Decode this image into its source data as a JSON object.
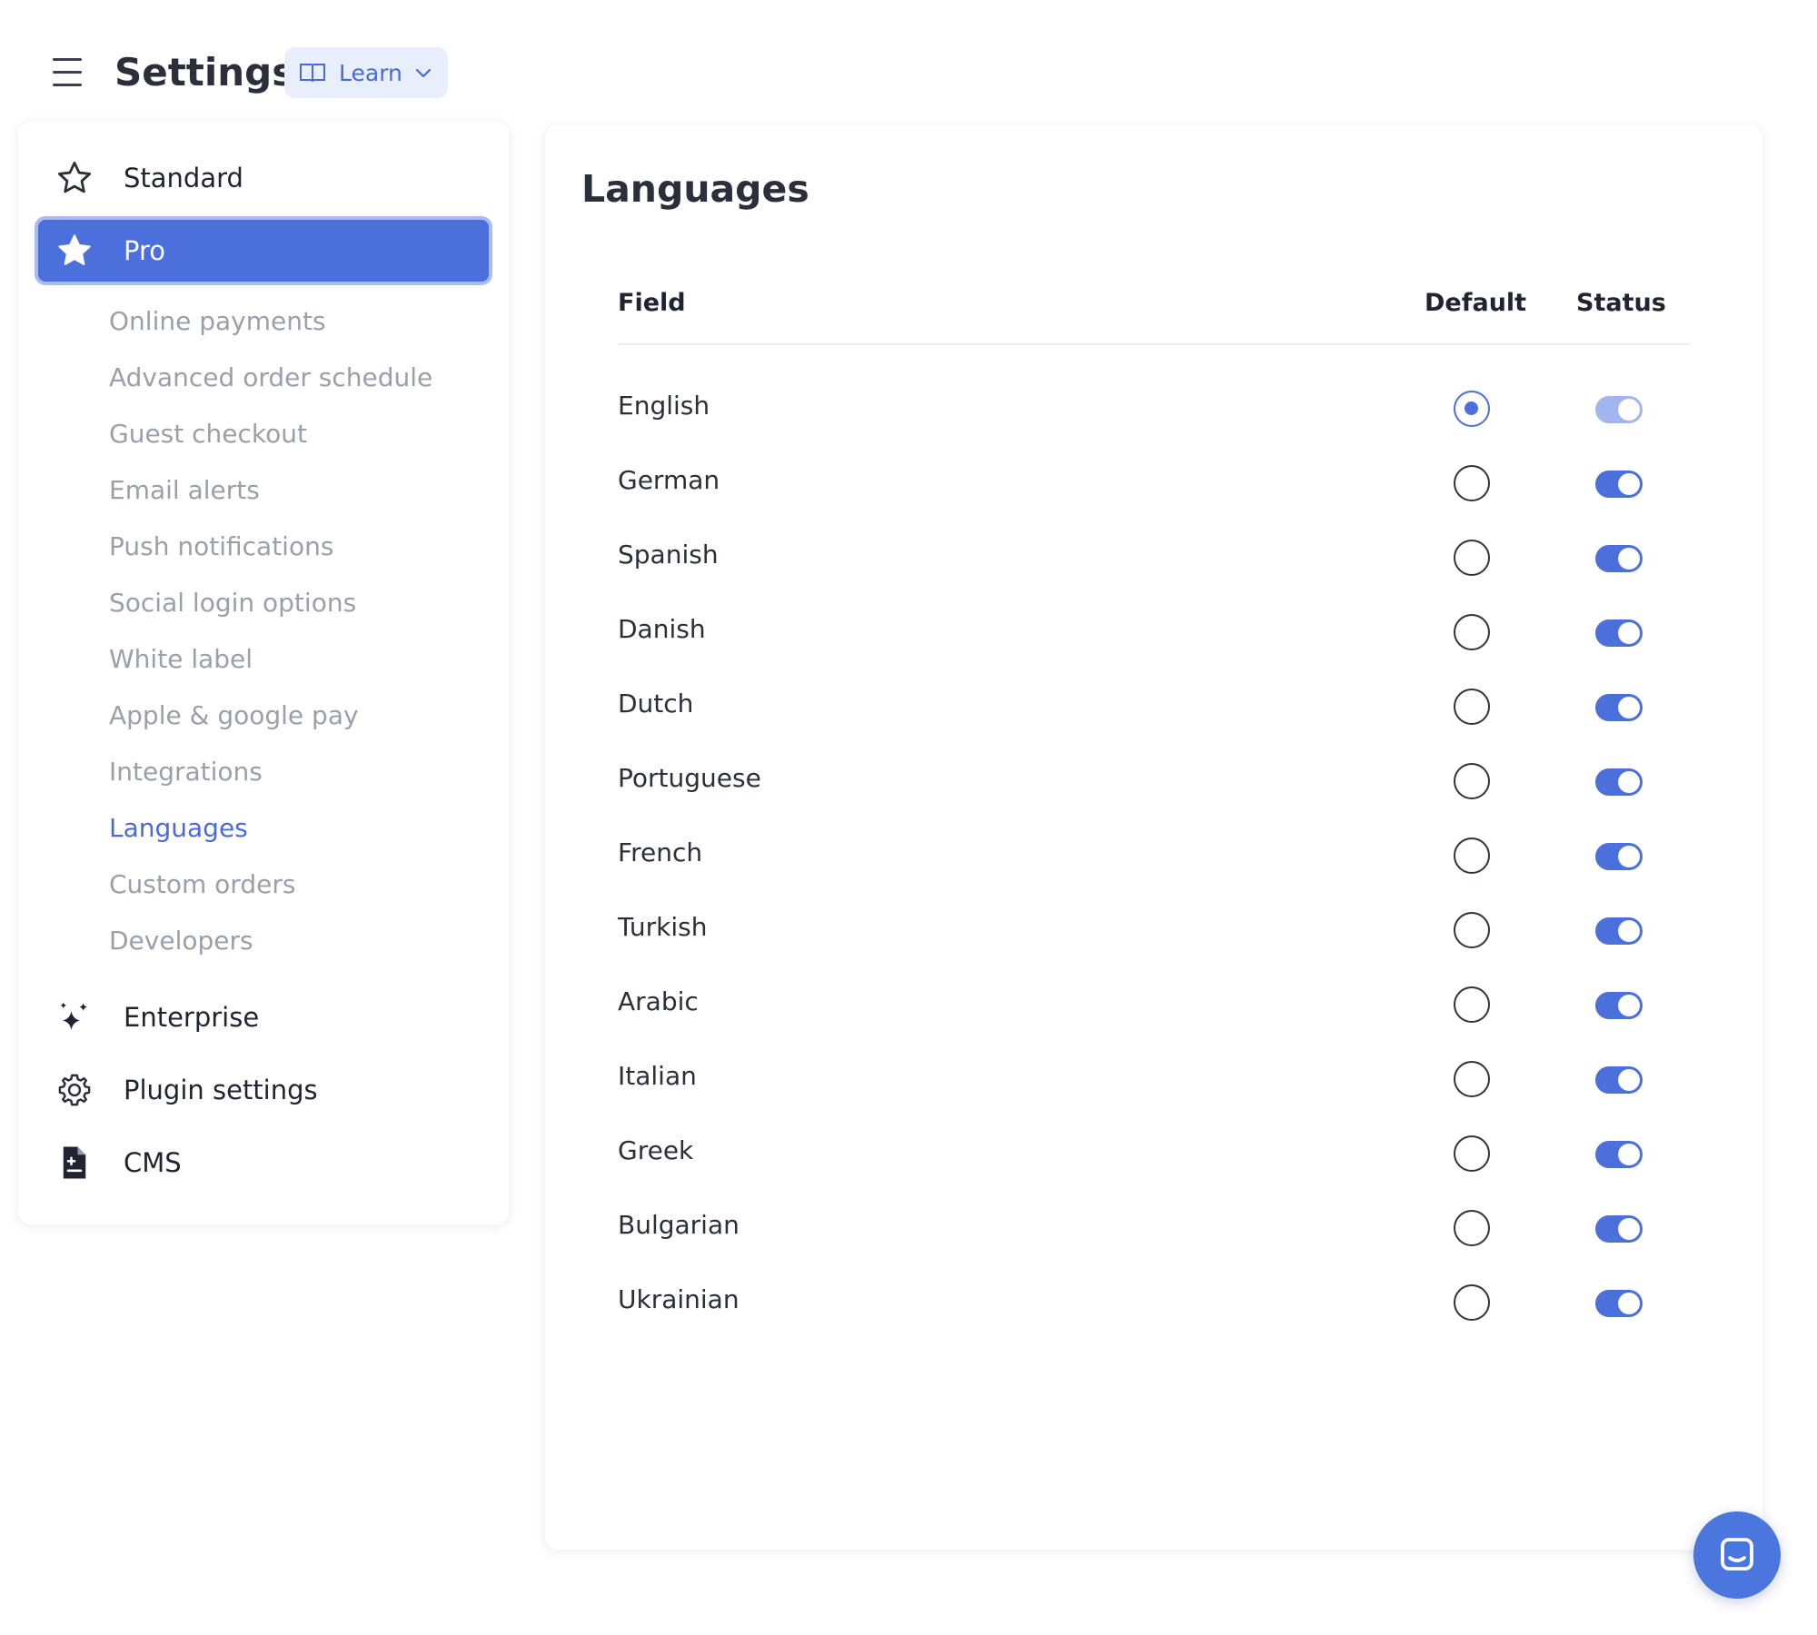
{
  "header": {
    "title": "Settings",
    "learn_label": "Learn"
  },
  "sidebar": {
    "items": [
      {
        "label": "Standard",
        "icon": "star-outline-icon"
      },
      {
        "label": "Pro",
        "icon": "star-filled-icon",
        "active": true
      },
      {
        "label": "Enterprise",
        "icon": "sparkles-icon"
      },
      {
        "label": "Plugin settings",
        "icon": "gear-icon"
      },
      {
        "label": "CMS",
        "icon": "document-icon"
      }
    ],
    "pro_subitems": [
      "Online payments",
      "Advanced order schedule",
      "Guest checkout",
      "Email alerts",
      "Push notifications",
      "Social login options",
      "White label",
      "Apple & google pay",
      "Integrations",
      "Languages",
      "Custom orders",
      "Developers"
    ],
    "current_subitem": "Languages"
  },
  "main": {
    "title": "Languages",
    "columns": {
      "field": "Field",
      "default": "Default",
      "status": "Status"
    },
    "rows": [
      {
        "language": "English",
        "default": true,
        "status": "on",
        "status_disabled": true
      },
      {
        "language": "German",
        "default": false,
        "status": "on"
      },
      {
        "language": "Spanish",
        "default": false,
        "status": "on"
      },
      {
        "language": "Danish",
        "default": false,
        "status": "on"
      },
      {
        "language": "Dutch",
        "default": false,
        "status": "on"
      },
      {
        "language": "Portuguese",
        "default": false,
        "status": "on"
      },
      {
        "language": "French",
        "default": false,
        "status": "on"
      },
      {
        "language": "Turkish",
        "default": false,
        "status": "on"
      },
      {
        "language": "Arabic",
        "default": false,
        "status": "on"
      },
      {
        "language": "Italian",
        "default": false,
        "status": "on"
      },
      {
        "language": "Greek",
        "default": false,
        "status": "on"
      },
      {
        "language": "Bulgarian",
        "default": false,
        "status": "on"
      },
      {
        "language": "Ukrainian",
        "default": false,
        "status": "on"
      }
    ]
  },
  "colors": {
    "accent": "#4b6fdb",
    "accent_light": "#a3b5ee",
    "muted_text": "#9aa0aa",
    "learn_bg": "#e8eefb"
  }
}
